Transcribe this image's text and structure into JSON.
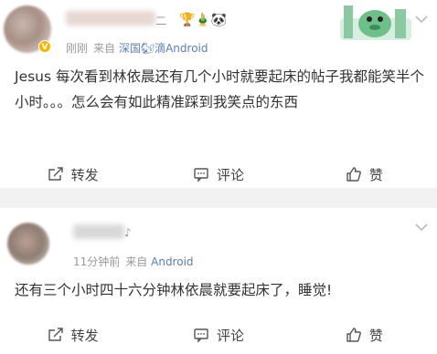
{
  "posts": [
    {
      "time": "刚刚",
      "source_prefix": "来自",
      "source": "深国🐿滴Android",
      "text": "Jesus 每次看到林依晨还有几个小时就要起床的帖子我都能笑半个小时。。。怎么会有如此精准踩到我笑点的东西",
      "name_tail": "二",
      "badges": "🏆🎍🐼",
      "actions": {
        "repost": "转发",
        "comment": "评论",
        "like": "赞"
      }
    },
    {
      "time": "11分钟前",
      "source_prefix": "来自",
      "source": "Android",
      "name_tail": "♪",
      "text": "还有三个小时四十六分钟林依晨就要起床了，睡觉!",
      "actions": {
        "repost": "转发",
        "comment": "评论",
        "like": "赞"
      }
    }
  ],
  "icons": {
    "more": "chevron-down-icon",
    "repost": "repost-icon",
    "comment": "comment-icon",
    "like": "like-icon"
  },
  "colors": {
    "source": "#5b7fb4",
    "meta": "#9a9a9a",
    "divider": "#f2f2f2"
  }
}
